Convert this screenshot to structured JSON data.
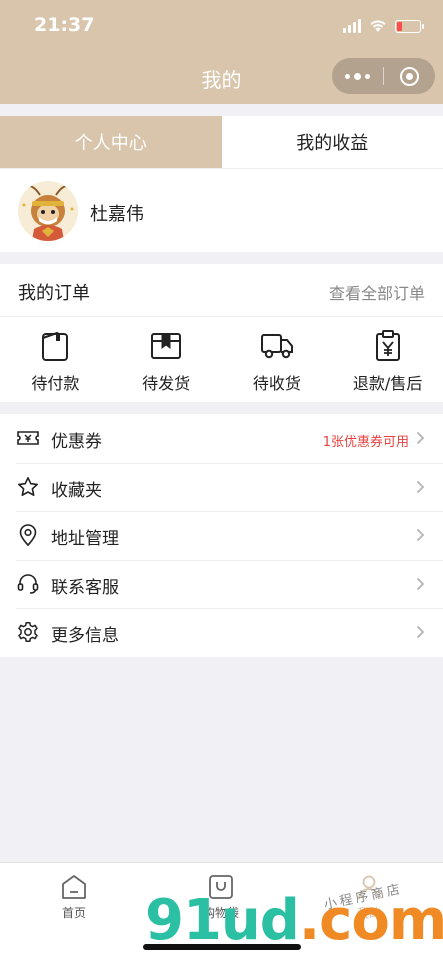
{
  "status_bar": {
    "time": "21:37",
    "battery_color": "#ff4d4f"
  },
  "nav": {
    "title": "我的",
    "more_icon": "more-dots-icon",
    "close_icon": "target-circle-icon"
  },
  "tabs": [
    {
      "label": "个人中心",
      "active": true
    },
    {
      "label": "我的收益",
      "active": false
    }
  ],
  "profile": {
    "name": "杜嘉伟"
  },
  "orders": {
    "title": "我的订单",
    "view_all": "查看全部订单",
    "items": [
      {
        "label": "待付款",
        "icon": "wallet-icon"
      },
      {
        "label": "待发货",
        "icon": "package-box-icon"
      },
      {
        "label": "待收货",
        "icon": "delivery-truck-icon"
      },
      {
        "label": "退款/售后",
        "icon": "refund-clipboard-icon"
      }
    ]
  },
  "menu": [
    {
      "label": "优惠券",
      "icon": "coupon-ticket-icon",
      "extra": "1张优惠券可用"
    },
    {
      "label": "收藏夹",
      "icon": "star-icon",
      "extra": ""
    },
    {
      "label": "地址管理",
      "icon": "location-pin-icon",
      "extra": ""
    },
    {
      "label": "联系客服",
      "icon": "headset-icon",
      "extra": ""
    },
    {
      "label": "更多信息",
      "icon": "gear-icon",
      "extra": ""
    }
  ],
  "tabbar": [
    {
      "label": "首页",
      "icon": "home-icon"
    },
    {
      "label": "购物袋",
      "icon": "shopping-bag-icon"
    },
    {
      "label": "我的",
      "icon": "person-icon"
    }
  ],
  "colors": {
    "brand": "#d8c5ac",
    "accent_red": "#e64340",
    "background": "#f1f1f5"
  },
  "watermark": {
    "main": "91ud",
    "suffix": ".com",
    "sub": "小程序商店"
  }
}
